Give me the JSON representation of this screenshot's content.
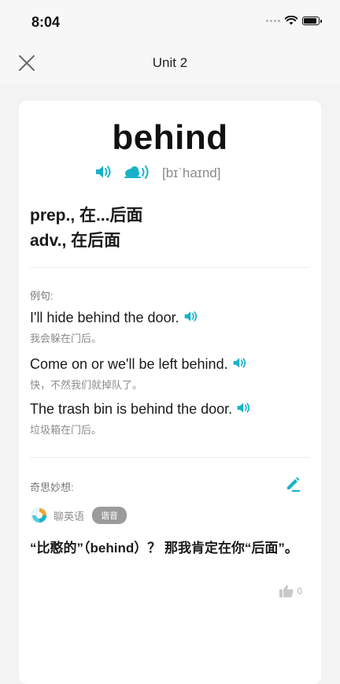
{
  "status": {
    "time": "8:04"
  },
  "nav": {
    "title": "Unit 2"
  },
  "word": {
    "headword": "behind",
    "phonetic": "[bɪˈhaɪnd]",
    "meanings": [
      "prep., 在...后面",
      "adv., 在后面"
    ]
  },
  "examples": {
    "label": "例句:",
    "items": [
      {
        "en": "I'll hide behind the door.",
        "cn": "我会躲在门后。"
      },
      {
        "en": "Come on or we'll be left behind.",
        "cn": "快，不然我们就掉队了。"
      },
      {
        "en": "The trash bin is behind the door.",
        "cn": "垃圾箱在门后。"
      }
    ]
  },
  "ideas": {
    "label": "奇思妙想:",
    "author": "聊英语",
    "badge": "谐音",
    "comment": "“比憨的”（behind）？ 那我肯定在你“后面”。",
    "likes": "0"
  },
  "colors": {
    "accent": "#16b3c9",
    "background": "#f3f3f4",
    "card": "#ffffff"
  },
  "icons": [
    "close-icon",
    "wifi-icon",
    "battery-icon",
    "speaker-icon",
    "slow-speaker-icon",
    "edit-icon",
    "thumbs-up-icon"
  ]
}
